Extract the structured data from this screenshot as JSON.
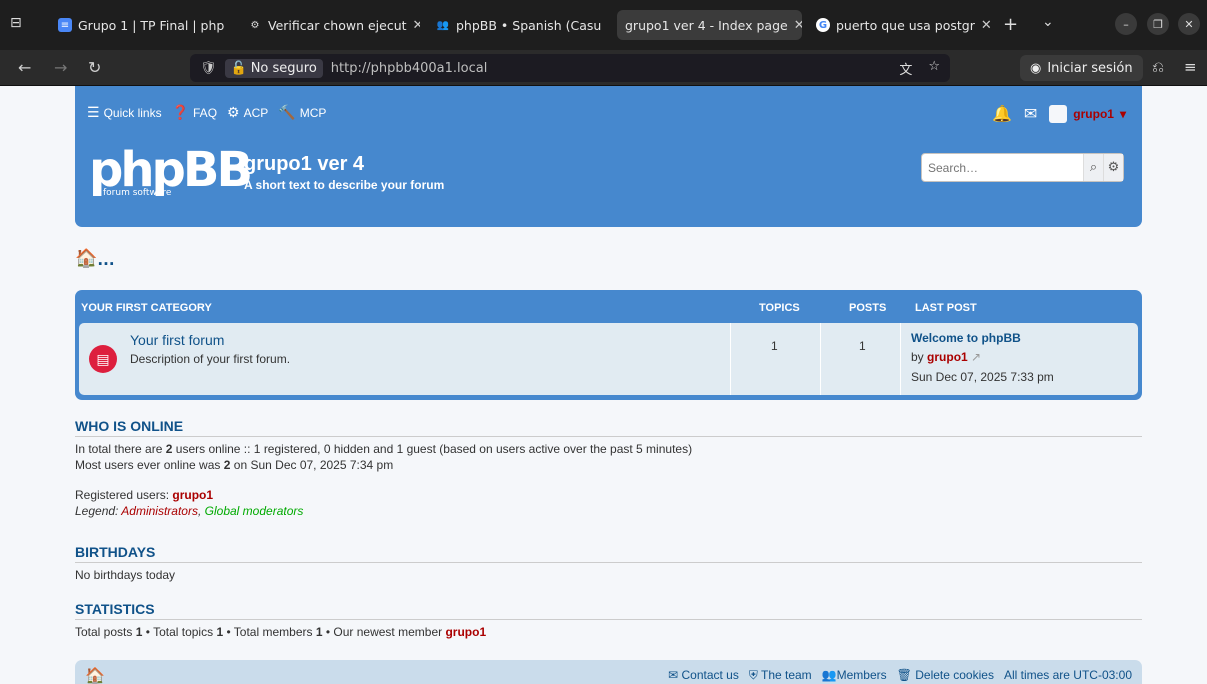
{
  "browser": {
    "tabs": [
      {
        "label": "Grupo 1 | TP Final | php",
        "icon": "docs-icon",
        "color": "#4a87f6"
      },
      {
        "label": "Verificar chown ejecut",
        "icon": "openai-icon",
        "color": "#444444"
      },
      {
        "label": "phpBB • Spanish (Casu",
        "icon": "users-icon",
        "color": "#444444"
      },
      {
        "label": "grupo1 ver 4 - Index page",
        "icon": "none",
        "color": "#3b3b3b"
      },
      {
        "label": "puerto que usa postgr",
        "icon": "google-icon",
        "color": "#ffffff"
      }
    ],
    "url_insecure_label": "No seguro",
    "url": "http://phpbb400a1.local",
    "signin_label": "Iniciar sesión"
  },
  "header": {
    "quick_links": "Quick links",
    "faq": "FAQ",
    "acp": "ACP",
    "mcp": "MCP",
    "username": "grupo1",
    "logo_text": "phpBB",
    "logo_sub": "forum software",
    "site_title": "grupo1 ver 4",
    "site_desc": "A short text to describe your forum",
    "search_placeholder": "Search…"
  },
  "breadcrumb": {
    "ellipsis": "..."
  },
  "forum_table": {
    "category": "YOUR FIRST CATEGORY",
    "col_topics": "TOPICS",
    "col_posts": "POSTS",
    "col_last_post": "LAST POST",
    "forum_name": "Your first forum",
    "forum_desc": "Description of your first forum.",
    "topics": "1",
    "posts": "1",
    "last_post_title": "Welcome to phpBB",
    "last_post_by": "by",
    "last_post_author": "grupo1",
    "last_post_date": "Sun Dec 07, 2025 7:33 pm"
  },
  "who_online": {
    "title": "WHO IS ONLINE",
    "line1_a": "In total there are",
    "line1_count": "2",
    "line1_b": "users online :: 1 registered, 0 hidden and 1 guest (based on users active over the past 5 minutes)",
    "line2_a": "Most users ever online was",
    "line2_count": "2",
    "line2_b": "on Sun Dec 07, 2025 7:34 pm",
    "registered_label": "Registered users:",
    "registered_user": "grupo1",
    "legend_label": "Legend:",
    "legend_admin": "Administrators",
    "legend_comma": ",",
    "legend_mods": "Global moderators"
  },
  "birthdays": {
    "title": "BIRTHDAYS",
    "text": "No birthdays today"
  },
  "statistics": {
    "title": "STATISTICS",
    "text_a": "Total posts",
    "posts": "1",
    "text_b": "• Total topics",
    "topics": "1",
    "text_c": "• Total members",
    "members": "1",
    "text_d": "• Our newest member",
    "newest": "grupo1"
  },
  "footer": {
    "contact": "Contact us",
    "team": "The team",
    "members": "Members",
    "delete_cookies": "Delete cookies",
    "times": "All times are UTC-03:00"
  }
}
